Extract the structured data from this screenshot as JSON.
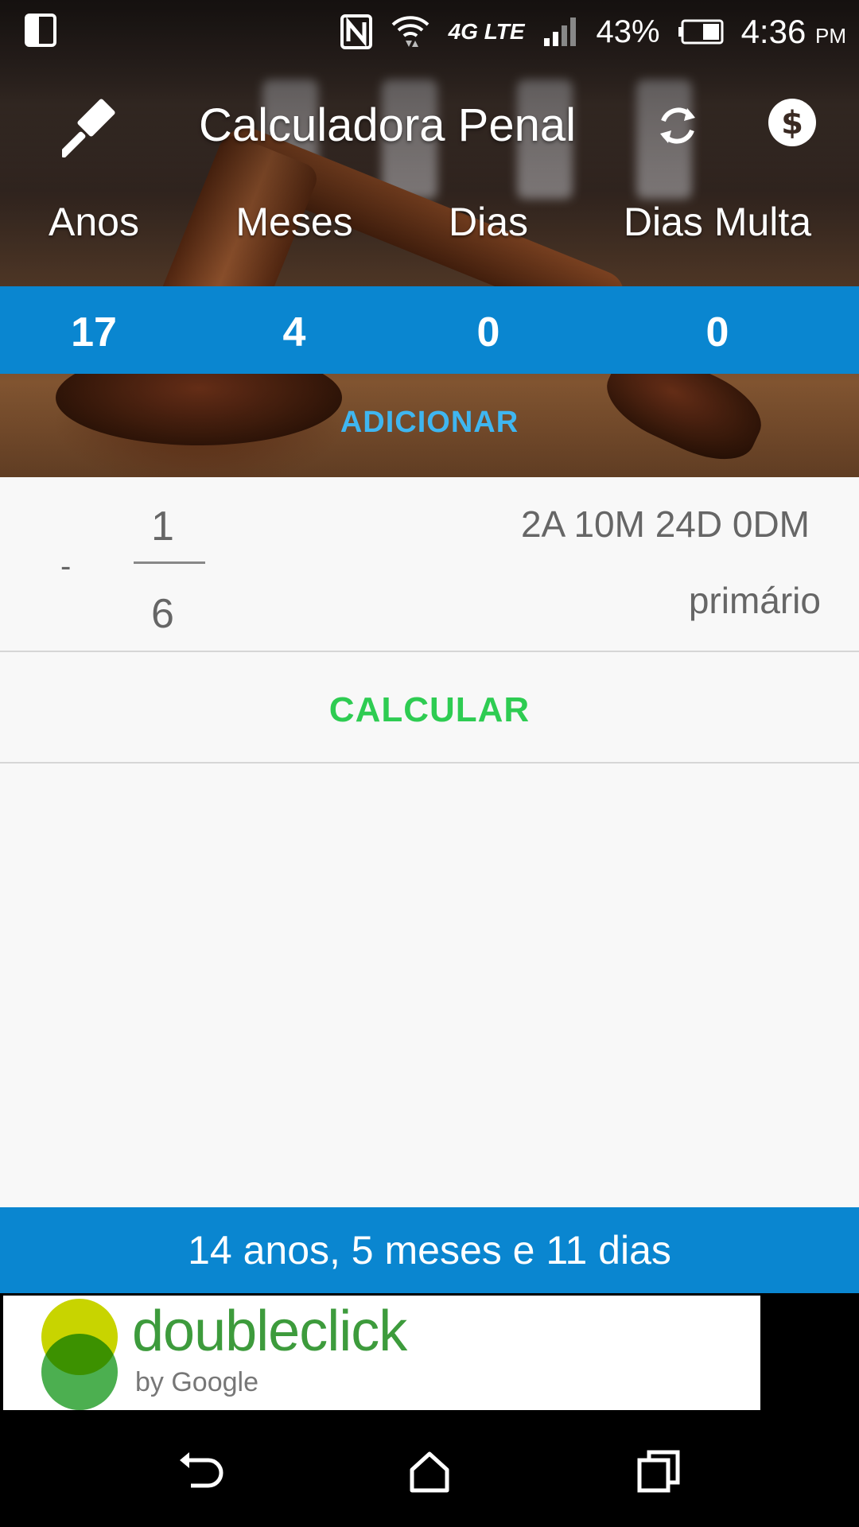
{
  "status_bar": {
    "battery": "43%",
    "time": "4:36",
    "ampm": "PM",
    "network": "4G LTE"
  },
  "app_bar": {
    "title": "Calculadora Penal",
    "icons": [
      "gavel-icon",
      "refresh-icon",
      "money-icon"
    ]
  },
  "penalty": {
    "headers": [
      "Anos",
      "Meses",
      "Dias",
      "Dias Multa"
    ],
    "values": [
      "17",
      "4",
      "0",
      "0"
    ],
    "add_label": "ADICIONAR"
  },
  "fraction_row": {
    "sign": "-",
    "numerator": "1",
    "denominator": "6",
    "result": "2A 10M 24D 0DM",
    "status": "primário"
  },
  "calculate_label": "CALCULAR",
  "final_result": "14 anos, 5 meses e 11 dias",
  "ad": {
    "brand": "doubleclick",
    "byline": "by Google"
  },
  "colors": {
    "accent_blue": "#0a86d0",
    "add_blue": "#3fb6f0",
    "calc_green": "#2ecc52"
  }
}
